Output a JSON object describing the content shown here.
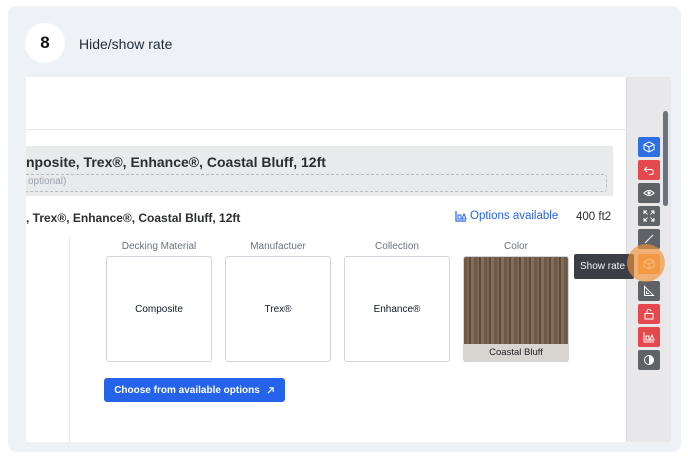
{
  "step": {
    "number": "8",
    "title": "Hide/show rate"
  },
  "product": {
    "name": "nposite, Trex®, Enhance®, Coastal Bluff, 12ft",
    "optional_placeholder": "optional)",
    "title": ", Trex®, Enhance®, Coastal Bluff, 12ft",
    "options_link": "Options available",
    "area": "400 ft2"
  },
  "attributes": [
    {
      "header": "Decking Material",
      "value": "Composite"
    },
    {
      "header": "Manufactuer",
      "value": "Trex®"
    },
    {
      "header": "Collection",
      "value": "Enhance®"
    },
    {
      "header": "Color",
      "value": "Coastal Bluff"
    }
  ],
  "choose_button": {
    "label": "Choose from available options",
    "icon": "arrow-up-right-icon"
  },
  "toolbar": {
    "tooltip": "Show rate",
    "buttons": [
      {
        "name": "cube-icon",
        "color": "#2f6fe4"
      },
      {
        "name": "undo-icon",
        "color": "#e5484d"
      },
      {
        "name": "eye-icon",
        "color": "#5f6368"
      },
      {
        "name": "expand-icon",
        "color": "#5f6368"
      },
      {
        "name": "rate-icon",
        "color": "#5f6368"
      },
      {
        "name": "cube-outline-icon",
        "color": "#f3a75b"
      },
      {
        "name": "ruler-triangle-icon",
        "color": "#5f6368"
      },
      {
        "name": "unlock-icon",
        "color": "#e5484d"
      },
      {
        "name": "shapes-icon",
        "color": "#e5484d"
      },
      {
        "name": "contrast-icon",
        "color": "#5f6368"
      }
    ]
  }
}
